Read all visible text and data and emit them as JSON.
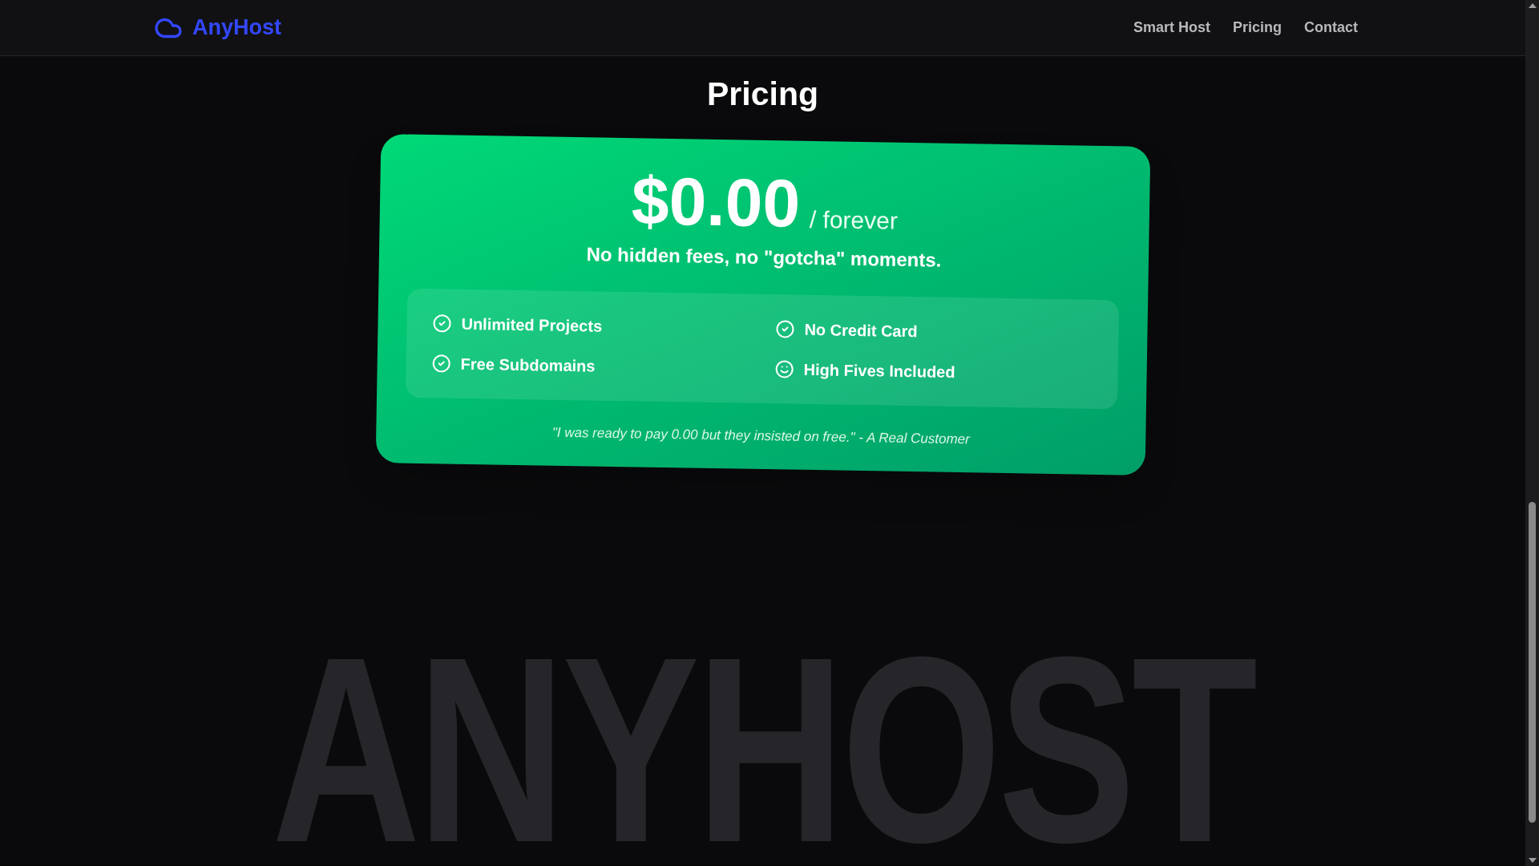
{
  "header": {
    "brand": "AnyHost",
    "nav": [
      "Smart Host",
      "Pricing",
      "Contact"
    ]
  },
  "section": {
    "title": "Pricing"
  },
  "card": {
    "price": "$0.00",
    "period": "/ forever",
    "tagline": "No hidden fees, no \"gotcha\" moments.",
    "features": [
      {
        "label": "Unlimited Projects",
        "kind": "check"
      },
      {
        "label": "No Credit Card",
        "kind": "check"
      },
      {
        "label": "Free Subdomains",
        "kind": "check"
      },
      {
        "label": "High Fives Included",
        "kind": "smile"
      }
    ],
    "quote": "\"I was ready to pay 0.00 but they insisted on free.\" - A Real Customer"
  },
  "background_text": "ANYHOST"
}
